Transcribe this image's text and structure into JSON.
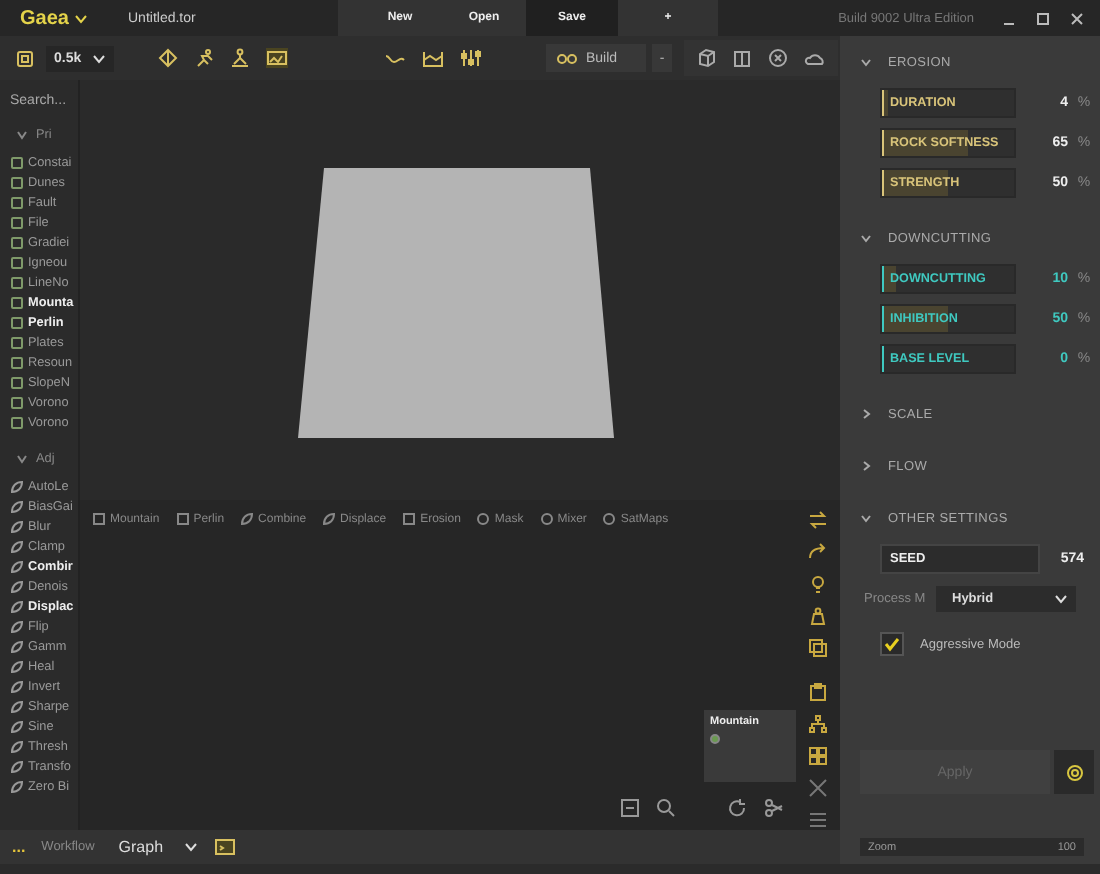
{
  "app": {
    "logo": "Gaea",
    "file": "Untitled.tor",
    "actions": [
      "New",
      "Open",
      "Save"
    ],
    "add": "+",
    "build_info": "Build 9002 Ultra Edition"
  },
  "toolbar": {
    "resolution": "0.5k",
    "build": "Build",
    "minus": "-"
  },
  "sidebar": {
    "search_placeholder": "Search...",
    "groups": [
      {
        "title": "Pri",
        "expanded": true,
        "kind": "primitive",
        "items": [
          {
            "label": "Constai",
            "used": false
          },
          {
            "label": "Dunes",
            "used": false
          },
          {
            "label": "Fault",
            "used": false
          },
          {
            "label": "File",
            "used": false
          },
          {
            "label": "Gradiei",
            "used": false
          },
          {
            "label": "Igneou",
            "used": false
          },
          {
            "label": "LineNo",
            "used": false
          },
          {
            "label": "Mounta",
            "used": true
          },
          {
            "label": "Perlin",
            "used": true
          },
          {
            "label": "Plates",
            "used": false
          },
          {
            "label": "Resoun",
            "used": false
          },
          {
            "label": "SlopeN",
            "used": false
          },
          {
            "label": "Vorono",
            "used": false
          },
          {
            "label": "Vorono",
            "used": false
          }
        ]
      },
      {
        "title": "Adj",
        "expanded": true,
        "kind": "adjust",
        "items": [
          {
            "label": "AutoLe",
            "used": false
          },
          {
            "label": "BiasGai",
            "used": false
          },
          {
            "label": "Blur",
            "used": false
          },
          {
            "label": "Clamp",
            "used": false
          },
          {
            "label": "Combir",
            "used": true
          },
          {
            "label": "Denois",
            "used": false
          },
          {
            "label": "Displac",
            "used": true
          },
          {
            "label": "Flip",
            "used": false
          },
          {
            "label": "Gamm",
            "used": false
          },
          {
            "label": "Heal",
            "used": false
          },
          {
            "label": "Invert",
            "used": false
          },
          {
            "label": "Sharpe",
            "used": false
          },
          {
            "label": "Sine",
            "used": false
          },
          {
            "label": "Thresh",
            "used": false
          },
          {
            "label": "Transfo",
            "used": false
          },
          {
            "label": "Zero Bi",
            "used": false
          }
        ]
      }
    ]
  },
  "node_bar": [
    {
      "label": "Mountain",
      "kind": "square"
    },
    {
      "label": "Perlin",
      "kind": "square"
    },
    {
      "label": "Combine",
      "kind": "leaf"
    },
    {
      "label": "Displace",
      "kind": "leaf"
    },
    {
      "label": "Erosion",
      "kind": "square"
    },
    {
      "label": "Mask",
      "kind": "circle"
    },
    {
      "label": "Mixer",
      "kind": "circle"
    },
    {
      "label": "SatMaps",
      "kind": "circle"
    }
  ],
  "graph": {
    "node": {
      "title": "Mountain"
    }
  },
  "bottom_bar": {
    "more": "...",
    "workflow_label": "Workflow",
    "workflow": "Graph"
  },
  "properties": {
    "sections": [
      {
        "title": "EROSION",
        "expanded": true,
        "fields": [
          {
            "kind": "slider",
            "label": "DURATION",
            "level": 0.04,
            "value": "4",
            "unit": "%",
            "color": "#d9c47a"
          },
          {
            "kind": "slider",
            "label": "ROCK SOFTNESS",
            "level": 0.65,
            "value": "65",
            "unit": "%",
            "color": "#d9c47a"
          },
          {
            "kind": "slider",
            "label": "STRENGTH",
            "level": 0.5,
            "value": "50",
            "unit": "%",
            "color": "#d9c47a"
          }
        ]
      },
      {
        "title": "DOWNCUTTING",
        "expanded": true,
        "fields": [
          {
            "kind": "slider",
            "label": "DOWNCUTTING",
            "level": 0.1,
            "value": "10",
            "unit": "%",
            "color": "#3fc9c0"
          },
          {
            "kind": "slider",
            "label": "INHIBITION",
            "level": 0.5,
            "value": "50",
            "unit": "%",
            "color": "#3fc9c0"
          },
          {
            "kind": "slider",
            "label": "BASE LEVEL",
            "level": 0,
            "value": "0",
            "unit": "%",
            "color": "#3fc9c0"
          }
        ]
      },
      {
        "title": "SCALE",
        "expanded": false
      },
      {
        "title": "FLOW",
        "expanded": false
      },
      {
        "title": "OTHER SETTINGS",
        "expanded": true,
        "fields": [
          {
            "kind": "number",
            "label": "SEED",
            "value": "574"
          },
          {
            "kind": "select",
            "label": "Process M",
            "value": "Hybrid"
          },
          {
            "kind": "checkbox",
            "label": "Aggressive Mode",
            "checked": true
          }
        ]
      }
    ],
    "apply": {
      "label": "Apply",
      "disabled": true
    },
    "zoom": {
      "label": "Zoom",
      "value": "100"
    }
  }
}
